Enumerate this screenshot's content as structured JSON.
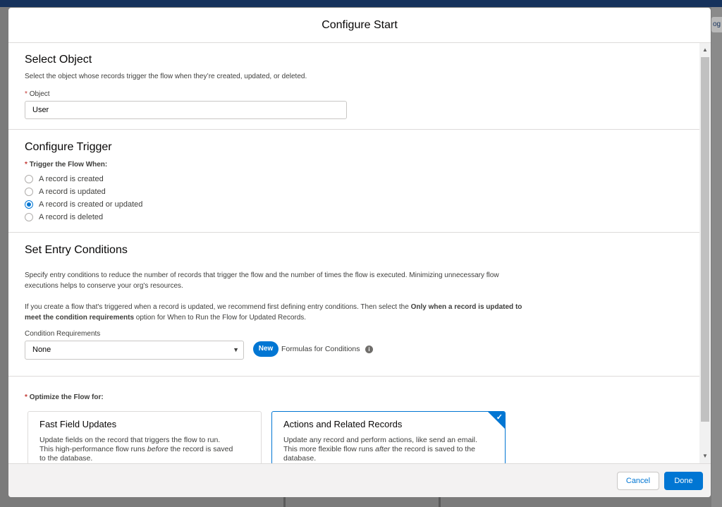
{
  "background": {
    "tab_text": "og"
  },
  "modal": {
    "title": "Configure Start"
  },
  "select_object": {
    "title": "Select Object",
    "description": "Select the object whose records trigger the flow when they’re created, updated, or deleted.",
    "required_mark": "*",
    "field_label": "Object",
    "field_value": "User"
  },
  "configure_trigger": {
    "title": "Configure Trigger",
    "required_mark": "*",
    "group_label": "Trigger the Flow When:",
    "options": [
      {
        "label": "A record is created",
        "selected": false
      },
      {
        "label": "A record is updated",
        "selected": false
      },
      {
        "label": "A record is created or updated",
        "selected": true
      },
      {
        "label": "A record is deleted",
        "selected": false
      }
    ]
  },
  "entry_conditions": {
    "title": "Set Entry Conditions",
    "paragraph1_line1": "Specify entry conditions to reduce the number of records that trigger the flow and the number of times the flow is executed. Minimizing unnecessary flow",
    "paragraph1_line2": "executions helps to conserve your org's resources.",
    "paragraph2_part1": "If you create a flow that's triggered when a record is updated, we recommend first defining entry conditions. Then select the ",
    "paragraph2_bold1": "Only when a record is updated to",
    "paragraph2_bold2": "meet the condition requirements",
    "paragraph2_part2": " option for When to Run the Flow for Updated Records.",
    "condition_label": "Condition Requirements",
    "condition_value": "None",
    "new_badge": "New",
    "formulas_label": "Formulas for Conditions"
  },
  "optimize": {
    "required_mark": "*",
    "label": "Optimize the Flow for:",
    "cards": [
      {
        "title": "Fast Field Updates",
        "line1": "Update fields on the record that triggers the flow to run.",
        "line2_pre": "This high-performance flow runs ",
        "line2_em": "before",
        "line2_post": " the record is saved",
        "line3": "to the database.",
        "selected": false
      },
      {
        "title": "Actions and Related Records",
        "line1": "Update any record and perform actions, like send an email.",
        "line2_pre": "This more flexible flow runs ",
        "line2_em": "after",
        "line2_post": " the record is saved to the",
        "line3": "database.",
        "selected": true
      }
    ]
  },
  "footer": {
    "cancel_label": "Cancel",
    "done_label": "Done"
  },
  "colors": {
    "brand": "#0176d3",
    "required": "#c23934",
    "header_bar": "#16325c"
  }
}
